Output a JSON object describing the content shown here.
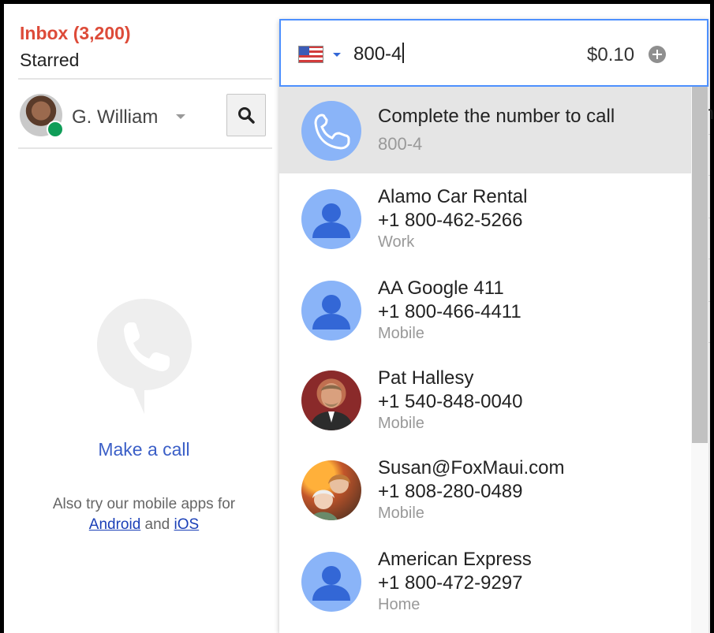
{
  "mail": {
    "inbox_label": "Inbox (3,200)",
    "starred_label": "Starred"
  },
  "user": {
    "name": "G. William",
    "status": "online"
  },
  "empty_state": {
    "make_call": "Make a call",
    "also_try": "Also try our mobile apps for",
    "android": "Android",
    "and": "and",
    "ios": "iOS"
  },
  "dialer": {
    "country": "US",
    "input_value": "800-4",
    "rate": "$0.10"
  },
  "background_fragment": "n",
  "suggestions": [
    {
      "name": "Complete the number to call",
      "detail": "800-4",
      "type": "",
      "avatar": "phone-icon",
      "highlighted": true
    },
    {
      "name": "Alamo Car Rental",
      "detail": "+1 800-462-5266",
      "type": "Work",
      "avatar": "generic"
    },
    {
      "name": "AA Google 411",
      "detail": "+1 800-466-4411",
      "type": "Mobile",
      "avatar": "generic"
    },
    {
      "name": "Pat Hallesy",
      "detail": "+1 540-848-0040",
      "type": "Mobile",
      "avatar": "photo"
    },
    {
      "name": "Susan@FoxMaui.com",
      "detail": "+1 808-280-0489",
      "type": "Mobile",
      "avatar": "photo"
    },
    {
      "name": "American Express",
      "detail": "+1 800-472-9297",
      "type": "Home",
      "avatar": "generic"
    }
  ],
  "colors": {
    "accent_blue": "#4d90fe",
    "inbox_red": "#dd4b39",
    "online_green": "#0f9d58",
    "avatar_blue": "#8ab4f8"
  }
}
